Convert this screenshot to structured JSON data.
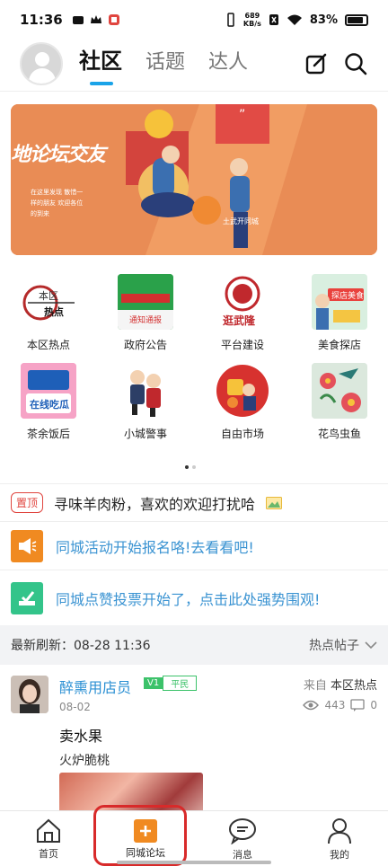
{
  "status_bar": {
    "time": "11:36",
    "speed_value": "689",
    "speed_unit": "KB/s",
    "battery": "83%"
  },
  "header": {
    "tabs": [
      {
        "label": "社区",
        "active": true
      },
      {
        "label": "话题",
        "active": false
      },
      {
        "label": "达人",
        "active": false
      }
    ],
    "icons": [
      "edit-icon",
      "search-icon"
    ]
  },
  "banner": {
    "title": "地论坛交友",
    "subtitle": "在这里发现 散惜一样的朋友 欢迎各位的到来",
    "stamp": "土武开同城"
  },
  "categories": [
    {
      "label": "本区热点",
      "thumb_text": "本区热点"
    },
    {
      "label": "政府公告",
      "thumb_text": "通知通报"
    },
    {
      "label": "平台建设",
      "thumb_text": "逛武隆"
    },
    {
      "label": "美食探店",
      "thumb_text": "探店美食"
    },
    {
      "label": "茶余饭后",
      "thumb_text": "在线吃瓜"
    },
    {
      "label": "小城警事",
      "thumb_text": ""
    },
    {
      "label": "自由市场",
      "thumb_text": ""
    },
    {
      "label": "花鸟虫鱼",
      "thumb_text": ""
    }
  ],
  "pinned": {
    "badge": "置顶",
    "text": "寻味羊肉粉，喜欢的欢迎打扰哈"
  },
  "notices": [
    {
      "text": "同城活动开始报名咯!去看看吧!",
      "color": "#f08a21",
      "icon": "megaphone-icon"
    },
    {
      "text": "同城点赞投票开始了，点击此处强势围观!",
      "color": "#33c48a",
      "icon": "vote-icon"
    }
  ],
  "refresh": {
    "text": "最新刷新：08-28 11:36",
    "sort": "热点帖子"
  },
  "post": {
    "author": "醉熏用店员",
    "v_badge": "V1",
    "level": "平民",
    "date": "08-02",
    "from_label": "来自",
    "from_section": "本区热点",
    "views": "443",
    "comments": "0",
    "title": "卖水果",
    "body": "火炉脆桃"
  },
  "bottom_nav": [
    {
      "label": "首页",
      "icon": "home-icon"
    },
    {
      "label": "同城论坛",
      "icon": "plus-icon",
      "active": true
    },
    {
      "label": "消息",
      "icon": "message-icon"
    },
    {
      "label": "我的",
      "icon": "profile-icon"
    }
  ]
}
